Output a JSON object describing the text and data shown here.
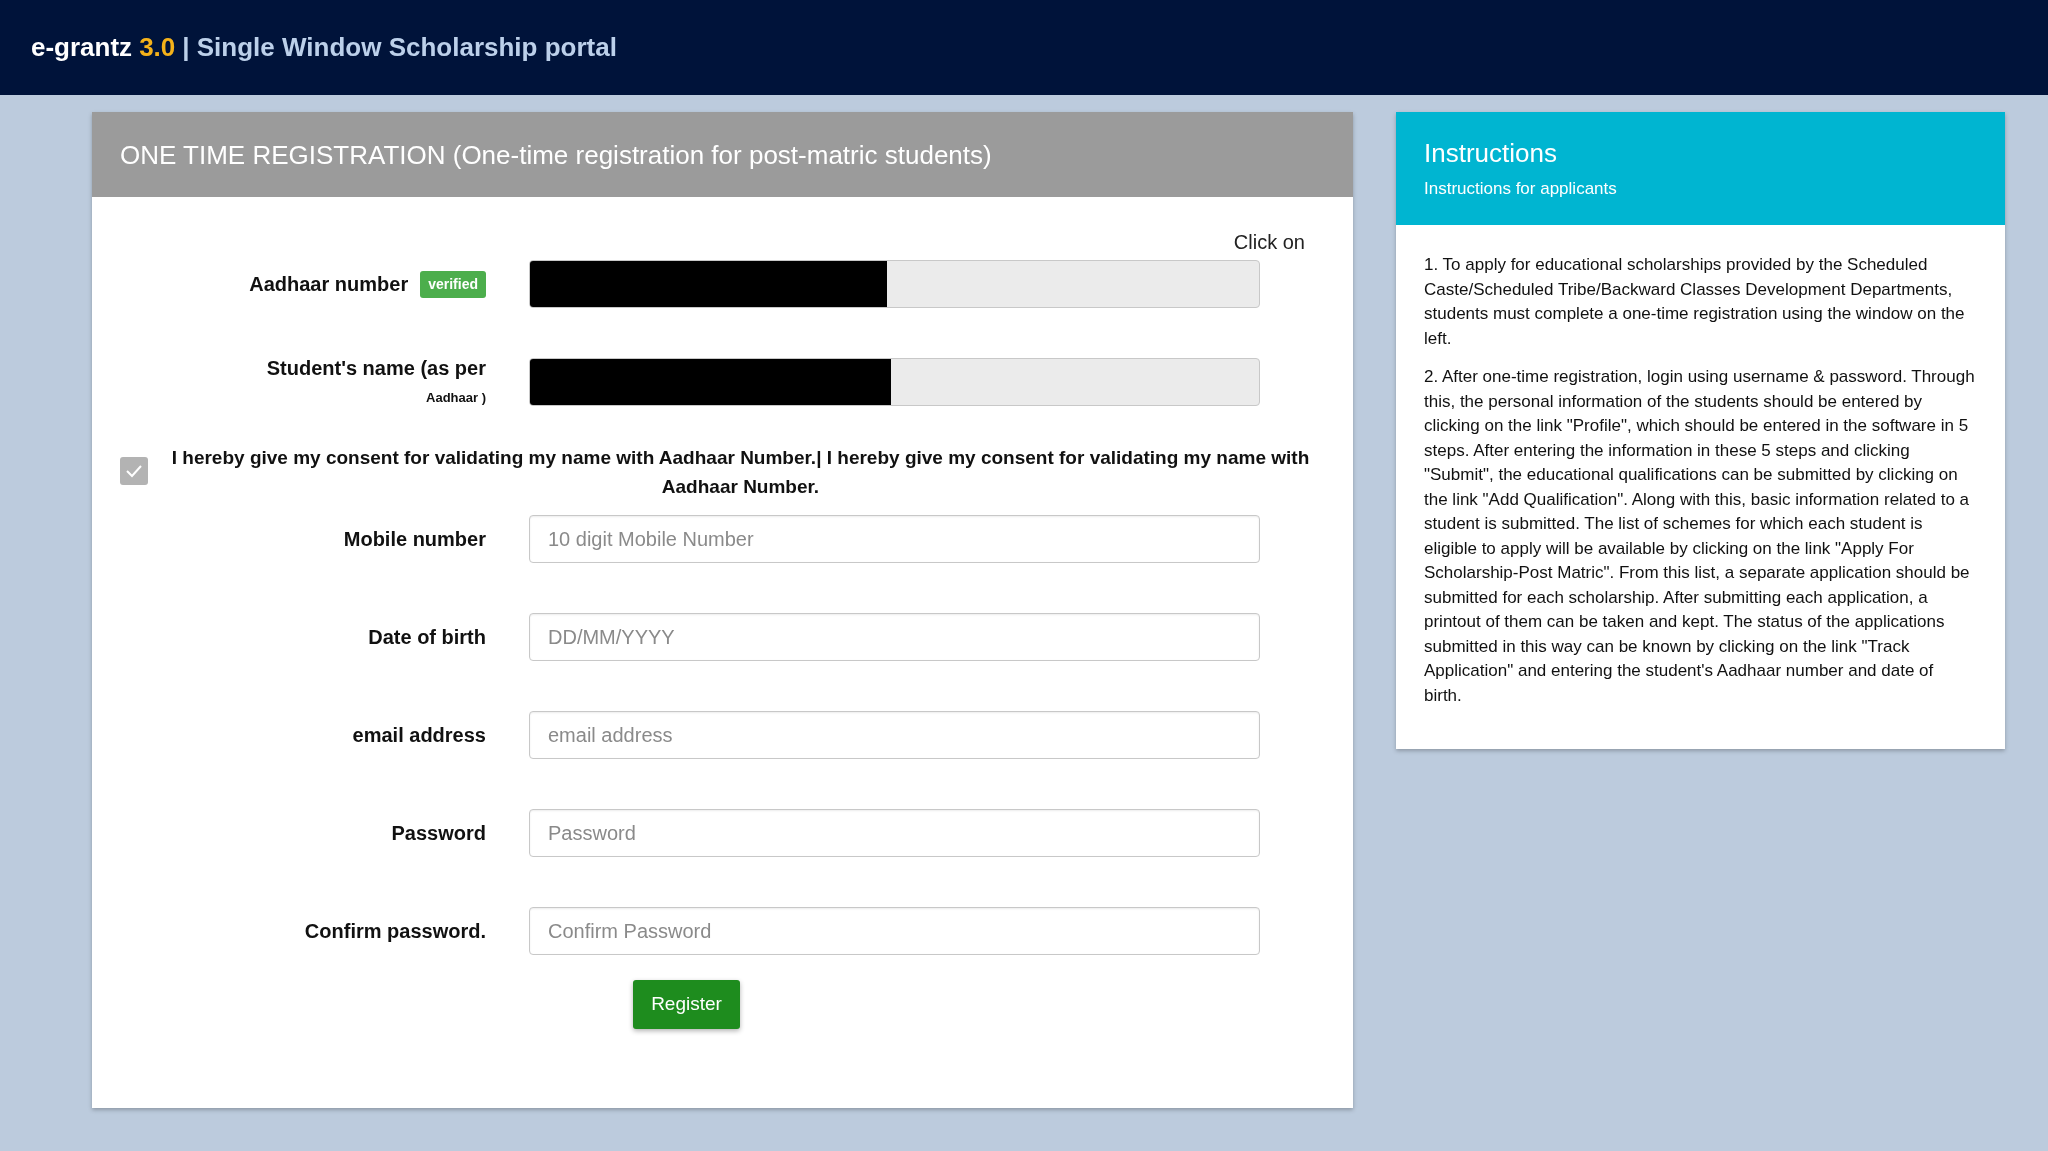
{
  "header": {
    "brand": "e-grantz",
    "version": "3.0",
    "title": "| Single Window Scholarship portal"
  },
  "registration": {
    "title": "ONE TIME REGISTRATION (One-time registration for post-matric students)",
    "hint": "Click on",
    "fields": [
      {
        "kind": "redacted",
        "label": "Aadhaar number",
        "badge": "verified",
        "level": 0.49
      },
      {
        "kind": "redacted",
        "label": "Student's name (as per",
        "label_note": "Aadhaar )",
        "level": 0.495
      },
      {
        "kind": "consent",
        "label": "I hereby give my consent for validating my name with Aadhaar Number.| I hereby give my consent for validating my name with Aadhaar Number.",
        "checked": true
      },
      {
        "kind": "text",
        "label": "Mobile number",
        "placeholder": "10 digit Mobile Number"
      },
      {
        "kind": "text",
        "label": "Date of birth",
        "placeholder": "DD/MM/YYYY"
      },
      {
        "kind": "text",
        "label": "email address",
        "placeholder": "email address"
      },
      {
        "kind": "text",
        "label": "Password",
        "placeholder": "Password"
      },
      {
        "kind": "text",
        "label": "Confirm password.",
        "placeholder": "Confirm Password"
      }
    ],
    "button": "Register"
  },
  "instructions": {
    "title": "Instructions",
    "subtitle": "Instructions for applicants",
    "paragraphs": [
      "1. To apply for educational scholarships provided by the Scheduled Caste/Scheduled Tribe/Backward Classes Development Departments, students must complete a one-time registration using the window on the left.",
      "2. After one-time registration, login using username & password. Through this, the personal information of the students should be entered by clicking on the link \"Profile\", which should be entered in the software in 5 steps. After entering the information in these 5 steps and clicking \"Submit\", the educational qualifications can be submitted by clicking on the link \"Add Qualification\". Along with this, basic information related to a student is submitted. The list of schemes for which each student is eligible to apply will be available by clicking on the link \"Apply For Scholarship-Post Matric\". From this list, a separate application should be submitted for each scholarship. After submitting each application, a printout of them can be taken and kept. The status of the applications submitted in this way can be known by clicking on the link \"Track Application\" and entering the student's Aadhaar number and date of birth."
    ]
  }
}
